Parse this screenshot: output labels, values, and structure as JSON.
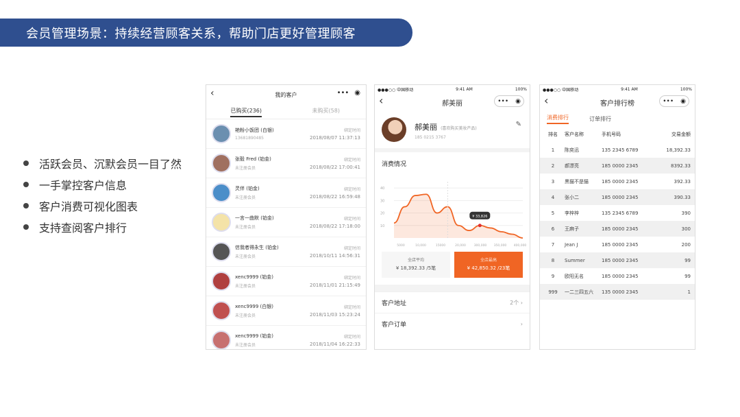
{
  "title": "会员管理场景：持续经营顾客关系，帮助门店更好管理顾客",
  "features": [
    "活跃会员、沉默会员一目了然",
    "一手掌控客户信息",
    "客户消费可视化图表",
    "支持查阅客户排行"
  ],
  "phone1": {
    "nav_title": "我的客户",
    "tabs": [
      "已购买(236)",
      "未购买(58)"
    ],
    "bind_label": "绑定时间",
    "customers": [
      {
        "name": "艳粉小饭团 (白银)",
        "sub": "13681890485",
        "time": "2018/08/07 11:37:13",
        "color": "#6b8fb0"
      },
      {
        "name": "张毅 Fred (铂金)",
        "sub": "未注册会员",
        "time": "2018/08/22 17:00:41",
        "color": "#a07060"
      },
      {
        "name": "灵伴 (铂金)",
        "sub": "未注册会员",
        "time": "2018/08/22 16:59:48",
        "color": "#4b8ec9"
      },
      {
        "name": "一言一曲默 (铂金)",
        "sub": "未注册会员",
        "time": "2018/08/22 17:18:00",
        "color": "#f4e3a8"
      },
      {
        "name": "信我者得永生 (铂金)",
        "sub": "未注册会员",
        "time": "2018/10/11 14:56:31",
        "color": "#555555"
      },
      {
        "name": "xenc9999 (铂金)",
        "sub": "未注册会员",
        "time": "2018/11/01 21:15:49",
        "color": "#b04040"
      },
      {
        "name": "xenc9999 (白银)",
        "sub": "未注册会员",
        "time": "2018/11/03 15:23:24",
        "color": "#c05050"
      },
      {
        "name": "xenc9999 (铂金)",
        "sub": "未注册会员",
        "time": "2018/11/04 16:22:33",
        "color": "#c77070"
      }
    ]
  },
  "phone2": {
    "status_left": "●●●○○ 中国移动 ",
    "status_time": "9:41 AM",
    "status_right": "100%",
    "nav_title": "郝美丽",
    "name": "郝美丽",
    "tag": "(喜欢购买美妆产品)",
    "phone": "185 0215 3767",
    "section": "消费情况",
    "y_ticks": [
      "40",
      "30",
      "20",
      "10"
    ],
    "x_ticks": [
      "5000",
      "10,000",
      "15000",
      "20,000",
      "300,000",
      "350,000",
      "400,000"
    ],
    "tooltip": "¥ 33,826",
    "chart_data": {
      "type": "area",
      "x": [
        0,
        1,
        2,
        3,
        4,
        5,
        6,
        7,
        8,
        9,
        10,
        11,
        12
      ],
      "y": [
        12,
        25,
        34,
        35,
        20,
        25,
        10,
        6,
        10,
        8,
        5,
        3,
        0
      ],
      "ylim": [
        0,
        45
      ],
      "color": "#f06524"
    },
    "stat1_label": "全店平均",
    "stat1_value": "¥ 18,392.33 /5笔",
    "stat2_label": "全店最高",
    "stat2_value": "¥ 42,850.32 /23笔",
    "link1": "客户地址",
    "link1_right": "2个",
    "link2": "客户订单"
  },
  "phone3": {
    "status_left": "●●●○○ 中国移动 ",
    "status_time": "9:41 AM",
    "status_right": "100%",
    "nav_title": "客户排行榜",
    "tabs": [
      "消费排行",
      "订单排行"
    ],
    "headers": [
      "排名",
      "客户名称",
      "手机号码",
      "交易金额"
    ],
    "rows": [
      [
        "1",
        "陈奕迅",
        "135 2345 6789",
        "18,392.33"
      ],
      [
        "2",
        "郝漂亮",
        "185 0000 2345",
        "8392.33"
      ],
      [
        "3",
        "黑猫不是猫",
        "185 0000 2345",
        "392.33"
      ],
      [
        "4",
        "张小二",
        "185 0000 2345",
        "390.33"
      ],
      [
        "5",
        "李梓梓",
        "135 2345 6789",
        "390"
      ],
      [
        "6",
        "王麻子",
        "185 0000 2345",
        "300"
      ],
      [
        "7",
        "Jean J",
        "185 0000 2345",
        "200"
      ],
      [
        "8",
        "Summer",
        "185 0000 2345",
        "99"
      ],
      [
        "9",
        "欧阳无名",
        "185 0000 2345",
        "99"
      ],
      [
        "999",
        "一二三四五六",
        "135 0000 2345",
        "1"
      ]
    ]
  }
}
